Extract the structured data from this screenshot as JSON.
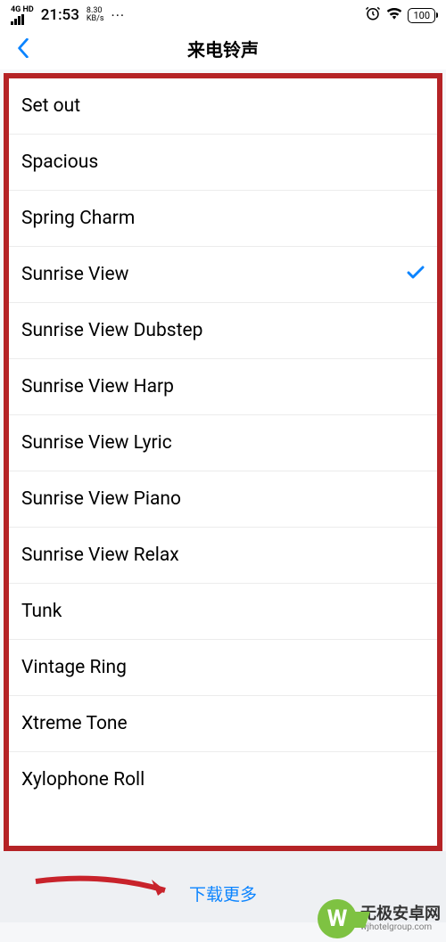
{
  "statusBar": {
    "signalLabel": "4G HD",
    "time": "21:53",
    "speedValue": "8.30",
    "speedUnit": "KB/s",
    "menuDots": "···",
    "battery": "100"
  },
  "nav": {
    "title": "来电铃声"
  },
  "ringtones": [
    {
      "label": "Set out",
      "selected": false
    },
    {
      "label": "Spacious",
      "selected": false
    },
    {
      "label": "Spring Charm",
      "selected": false
    },
    {
      "label": "Sunrise View",
      "selected": true
    },
    {
      "label": "Sunrise View Dubstep",
      "selected": false
    },
    {
      "label": "Sunrise View Harp",
      "selected": false
    },
    {
      "label": "Sunrise View Lyric",
      "selected": false
    },
    {
      "label": "Sunrise View Piano",
      "selected": false
    },
    {
      "label": "Sunrise View Relax",
      "selected": false
    },
    {
      "label": "Tunk",
      "selected": false
    },
    {
      "label": "Vintage Ring",
      "selected": false
    },
    {
      "label": "Xtreme Tone",
      "selected": false
    },
    {
      "label": "Xylophone Roll",
      "selected": false
    }
  ],
  "bottom": {
    "downloadMore": "下载更多"
  },
  "watermark": {
    "logoLetter": "W",
    "main": "无极安卓网",
    "sub": "wjhotelgroup.com"
  }
}
